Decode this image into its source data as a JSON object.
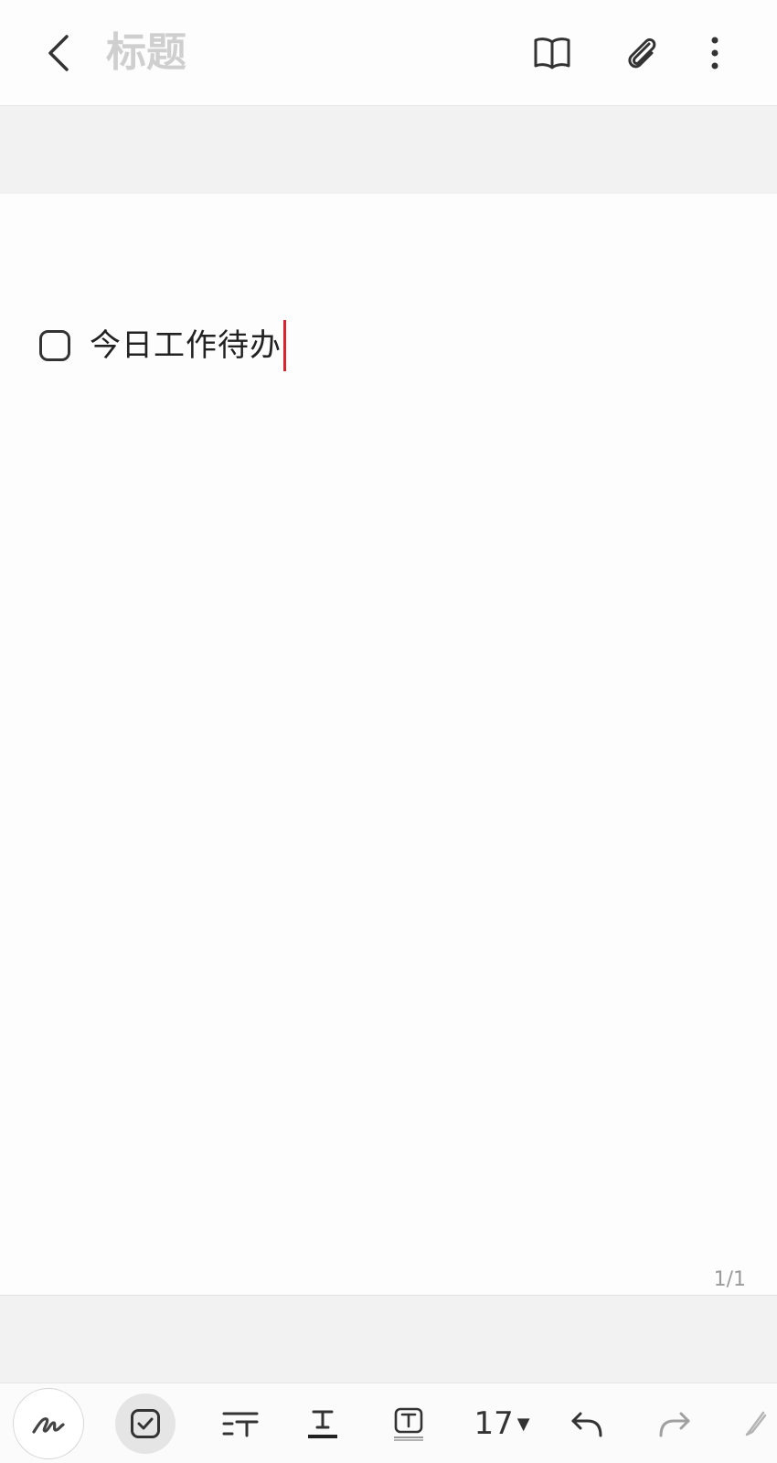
{
  "header": {
    "title_placeholder": "标题",
    "icons": {
      "back": "chevron-left-icon",
      "read_mode": "book-icon",
      "attach": "paperclip-icon",
      "more": "more-vertical-icon"
    }
  },
  "note": {
    "checklist_items": [
      {
        "text": "今日工作待办",
        "checked": false
      }
    ],
    "page_indicator": "1/1"
  },
  "toolbar": {
    "font_size": "17",
    "icons": {
      "pen": "handwriting-pen-icon",
      "checklist": "checkbox-icon",
      "text_style": "paragraph-style-icon",
      "text_color": "text-color-icon",
      "highlight": "text-highlight-icon",
      "undo": "undo-icon",
      "redo": "redo-icon",
      "edge": "pen-nib-icon"
    }
  },
  "colors": {
    "caret": "#e0202a",
    "band": "#f2f2f2",
    "placeholder": "#cfcfcf"
  }
}
